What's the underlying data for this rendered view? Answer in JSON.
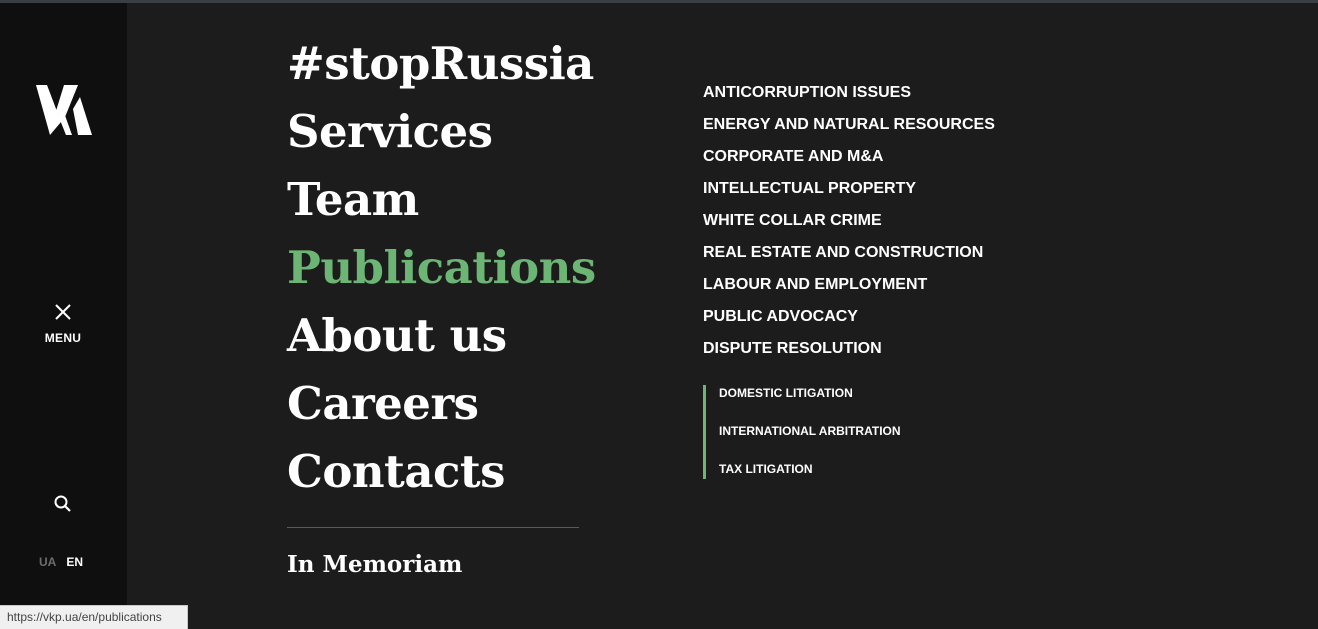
{
  "sidebar": {
    "logo_icon": "vkp-logo-icon",
    "menu_close_icon": "close-icon",
    "menu_label": "MENU",
    "search_icon": "search-icon",
    "languages": [
      "UA",
      "EN"
    ],
    "active_language": "EN"
  },
  "main_nav": {
    "items": [
      "#stopRussia",
      "Services",
      "Team",
      "Publications",
      "About us",
      "Careers",
      "Contacts"
    ],
    "active": "Publications",
    "memoriam": "In Memoriam"
  },
  "services": {
    "items": [
      "ANTICORRUPTION ISSUES",
      "ENERGY AND NATURAL RESOURCES",
      "CORPORATE AND M&A",
      "INTELLECTUAL PROPERTY",
      "WHITE COLLAR CRIME",
      "REAL ESTATE AND CONSTRUCTION",
      "LABOUR AND EMPLOYMENT",
      "PUBLIC ADVOCACY",
      "DISPUTE RESOLUTION"
    ],
    "sub_items": [
      "DOMESTIC LITIGATION",
      "INTERNATIONAL ARBITRATION",
      "TAX LITIGATION"
    ]
  },
  "status_bar": {
    "url": "https://vkp.ua/en/publications"
  },
  "colors": {
    "accent": "#6cb574",
    "background": "#1c1c1c",
    "sidebar": "#0f0f0f",
    "text": "#ffffff"
  }
}
